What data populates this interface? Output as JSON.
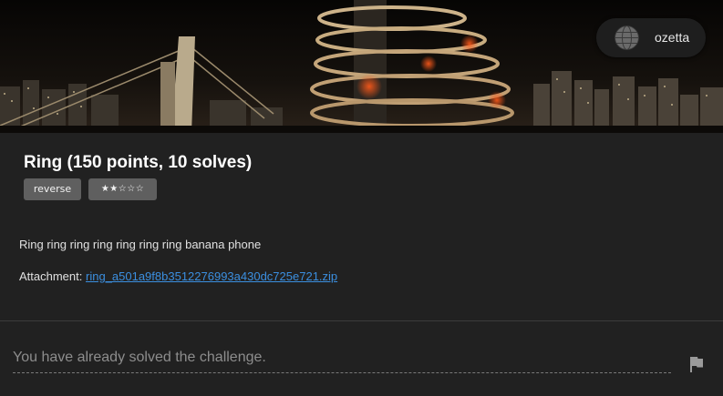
{
  "user": {
    "name": "ozetta",
    "icon": "globe-avatar-icon"
  },
  "challenge": {
    "title": "Ring (150 points, 10 solves)",
    "category": "reverse",
    "difficulty_stars": "★★☆☆☆",
    "difficulty_level": 2,
    "description": "Ring ring ring ring ring ring ring banana phone",
    "attachment_label": "Attachment:",
    "attachment_name": "ring_a501a9f8b3512276993a430dc725e721.zip"
  },
  "submission": {
    "message": "You have already solved the challenge.",
    "submit_icon": "flag-icon"
  },
  "colors": {
    "background": "#212121",
    "tag": "#5f5f5f",
    "link": "#3b8fe0",
    "muted_text": "#8d8d8d"
  }
}
